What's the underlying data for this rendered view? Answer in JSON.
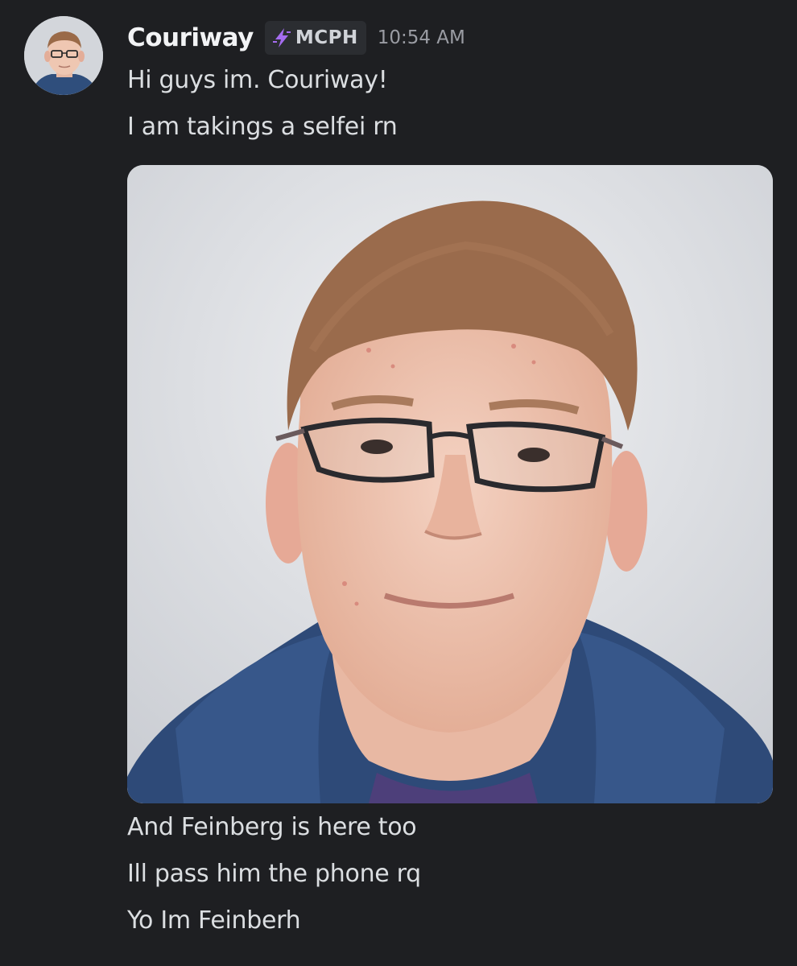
{
  "message": {
    "author": "Couriway",
    "tag": {
      "icon": "lightning-bolt-icon",
      "label": "MCPH"
    },
    "timestamp": "10:54 AM",
    "lines_before_image": [
      "Hi guys im. Couriway!",
      "I am takings a selfei rn"
    ],
    "lines_after_image": [
      "And Feinberg is here too",
      "Ill pass him the phone rq",
      "Yo Im Feinberh"
    ]
  },
  "colors": {
    "background": "#1e1f22",
    "username": "#f2f3f5",
    "message_text": "#dbdee1",
    "timestamp": "#9a9ca3",
    "tag_background": "#2b2d31",
    "tag_icon": "#a56cf0"
  }
}
